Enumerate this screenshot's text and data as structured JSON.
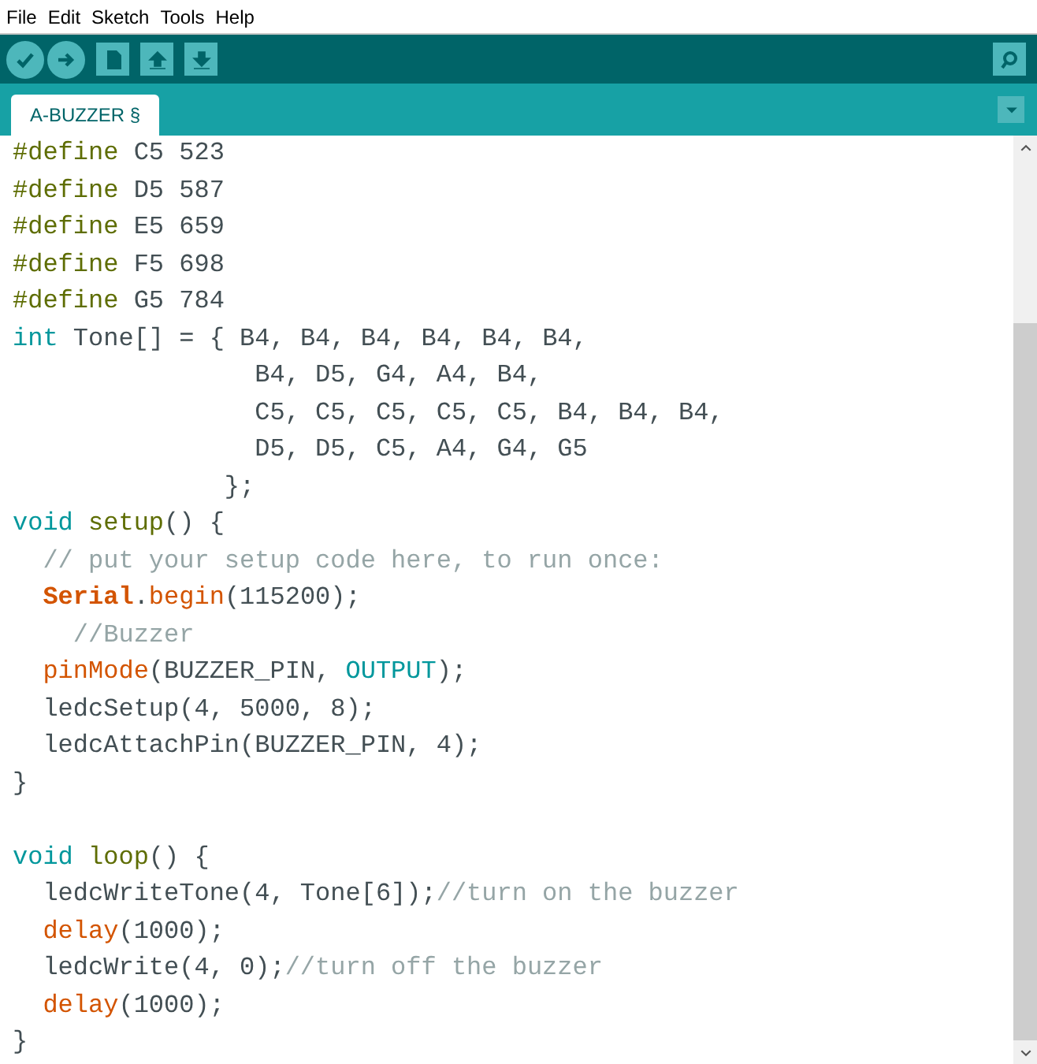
{
  "menu_bar": [
    "File",
    "Edit",
    "Sketch",
    "Tools",
    "Help"
  ],
  "tabs": [
    {
      "label": "A-BUZZER §",
      "selected": true
    }
  ],
  "code_lines": [
    {
      "tokens": [
        {
          "kind": "directive",
          "text": "#define"
        },
        {
          "kind": "plain",
          "text": " C5 523"
        }
      ]
    },
    {
      "tokens": [
        {
          "kind": "directive",
          "text": "#define"
        },
        {
          "kind": "plain",
          "text": " D5 587"
        }
      ]
    },
    {
      "tokens": [
        {
          "kind": "directive",
          "text": "#define"
        },
        {
          "kind": "plain",
          "text": " E5 659"
        }
      ]
    },
    {
      "tokens": [
        {
          "kind": "directive",
          "text": "#define"
        },
        {
          "kind": "plain",
          "text": " F5 698"
        }
      ]
    },
    {
      "tokens": [
        {
          "kind": "directive",
          "text": "#define"
        },
        {
          "kind": "plain",
          "text": " G5 784"
        }
      ]
    },
    {
      "tokens": [
        {
          "kind": "type",
          "text": "int"
        },
        {
          "kind": "plain",
          "text": " Tone[] = { B4, B4, B4, B4, B4, B4,"
        }
      ]
    },
    {
      "tokens": [
        {
          "kind": "plain",
          "text": "                B4, D5, G4, A4, B4,"
        }
      ]
    },
    {
      "tokens": [
        {
          "kind": "plain",
          "text": "                C5, C5, C5, C5, C5, B4, B4, B4,"
        }
      ]
    },
    {
      "tokens": [
        {
          "kind": "plain",
          "text": "                D5, D5, C5, A4, G4, G5"
        }
      ]
    },
    {
      "tokens": [
        {
          "kind": "plain",
          "text": "              };"
        }
      ]
    },
    {
      "tokens": [
        {
          "kind": "type",
          "text": "void "
        },
        {
          "kind": "function",
          "text": "setup"
        },
        {
          "kind": "plain",
          "text": "() {"
        }
      ]
    },
    {
      "tokens": [
        {
          "kind": "comment",
          "text": "  // put your setup code here, to run once:"
        }
      ]
    },
    {
      "indented": true,
      "tokens": [
        {
          "kind": "object",
          "text": "Serial"
        },
        {
          "kind": "plain",
          "text": "."
        },
        {
          "kind": "builtin",
          "text": "begin"
        },
        {
          "kind": "plain",
          "text": "(115200);"
        }
      ]
    },
    {
      "tokens": [
        {
          "kind": "comment",
          "text": "    //Buzzer"
        }
      ]
    },
    {
      "indented": true,
      "tokens": [
        {
          "kind": "builtin",
          "text": "pinMode"
        },
        {
          "kind": "plain",
          "text": "(BUZZER_PIN, "
        },
        {
          "kind": "constant",
          "text": "OUTPUT"
        },
        {
          "kind": "plain",
          "text": ");"
        }
      ]
    },
    {
      "tokens": [
        {
          "kind": "plain",
          "text": "  ledcSetup(4, 5000, 8);"
        }
      ]
    },
    {
      "tokens": [
        {
          "kind": "plain",
          "text": "  ledcAttachPin(BUZZER_PIN, 4);"
        }
      ]
    },
    {
      "tokens": [
        {
          "kind": "plain",
          "text": "}"
        }
      ]
    },
    {
      "kind": "blank"
    },
    {
      "tokens": [
        {
          "kind": "type",
          "text": "void "
        },
        {
          "kind": "function",
          "text": "loop"
        },
        {
          "kind": "plain",
          "text": "() {"
        }
      ]
    },
    {
      "tokens": [
        {
          "kind": "plain",
          "text": "  ledcWriteTone(4, Tone[6]);"
        },
        {
          "kind": "comment",
          "text": "//turn on the buzzer"
        }
      ]
    },
    {
      "indented": true,
      "tokens": [
        {
          "kind": "builtin",
          "text": "delay"
        },
        {
          "kind": "plain",
          "text": "(1000);"
        }
      ]
    },
    {
      "tokens": [
        {
          "kind": "plain",
          "text": "  ledcWrite(4, 0);"
        },
        {
          "kind": "comment",
          "text": "//turn off the buzzer"
        }
      ]
    },
    {
      "indented": true,
      "tokens": [
        {
          "kind": "builtin",
          "text": "delay"
        },
        {
          "kind": "plain",
          "text": "(1000);"
        }
      ]
    },
    {
      "tokens": [
        {
          "kind": "plain",
          "text": "}"
        }
      ]
    }
  ]
}
